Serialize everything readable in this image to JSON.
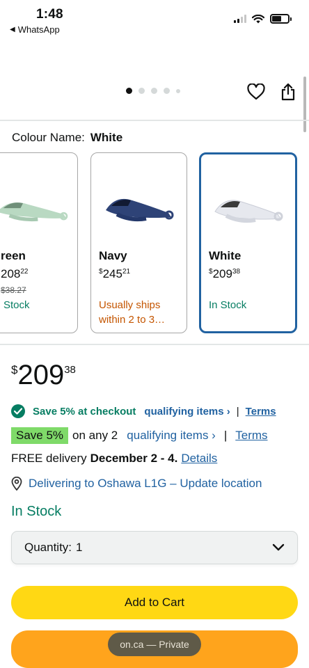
{
  "status_bar": {
    "time": "1:48",
    "back_app": "WhatsApp"
  },
  "gallery": {
    "dot_count": 5,
    "active_dot": 0
  },
  "colour": {
    "label": "Colour Name:",
    "selected": "White",
    "swatches": [
      {
        "name": "reen",
        "price_whole": "208",
        "price_frac": "22",
        "old_price": "$38.27",
        "availability": "Stock",
        "availability_color": "#067d62"
      },
      {
        "name": "Navy",
        "price_symbol": "$",
        "price_whole": "245",
        "price_frac": "21",
        "availability": "Usually ships within 2 to 3…",
        "availability_color": "#c45500"
      },
      {
        "name": "White",
        "price_symbol": "$",
        "price_whole": "209",
        "price_frac": "38",
        "availability": "In Stock",
        "availability_color": "#067d62"
      }
    ]
  },
  "price": {
    "symbol": "$",
    "whole": "209",
    "fraction": "38"
  },
  "promo": {
    "save_text": "Save 5% at checkout",
    "qualifying_link": "qualifying items ›",
    "separator": "|",
    "terms": "Terms"
  },
  "promo2": {
    "badge": "Save 5%",
    "text": "on any 2",
    "qualifying_link": "qualifying items ›",
    "separator": "|",
    "terms": "Terms"
  },
  "delivery": {
    "prefix": "FREE delivery",
    "dates": "December 2 - 4.",
    "details_link": "Details",
    "location": "Delivering to Oshawa L1G – Update location"
  },
  "stock": "In Stock",
  "quantity": {
    "label": "Quantity:",
    "value": "1"
  },
  "buttons": {
    "add_to_cart": "Add to Cart"
  },
  "browser_toast": "on.ca — Private",
  "colors": {
    "accent_link": "#2162a1",
    "in_stock": "#067d62",
    "add_to_cart": "#ffd814",
    "buy_now": "#ffa41c",
    "selected_border": "#2162a1"
  }
}
